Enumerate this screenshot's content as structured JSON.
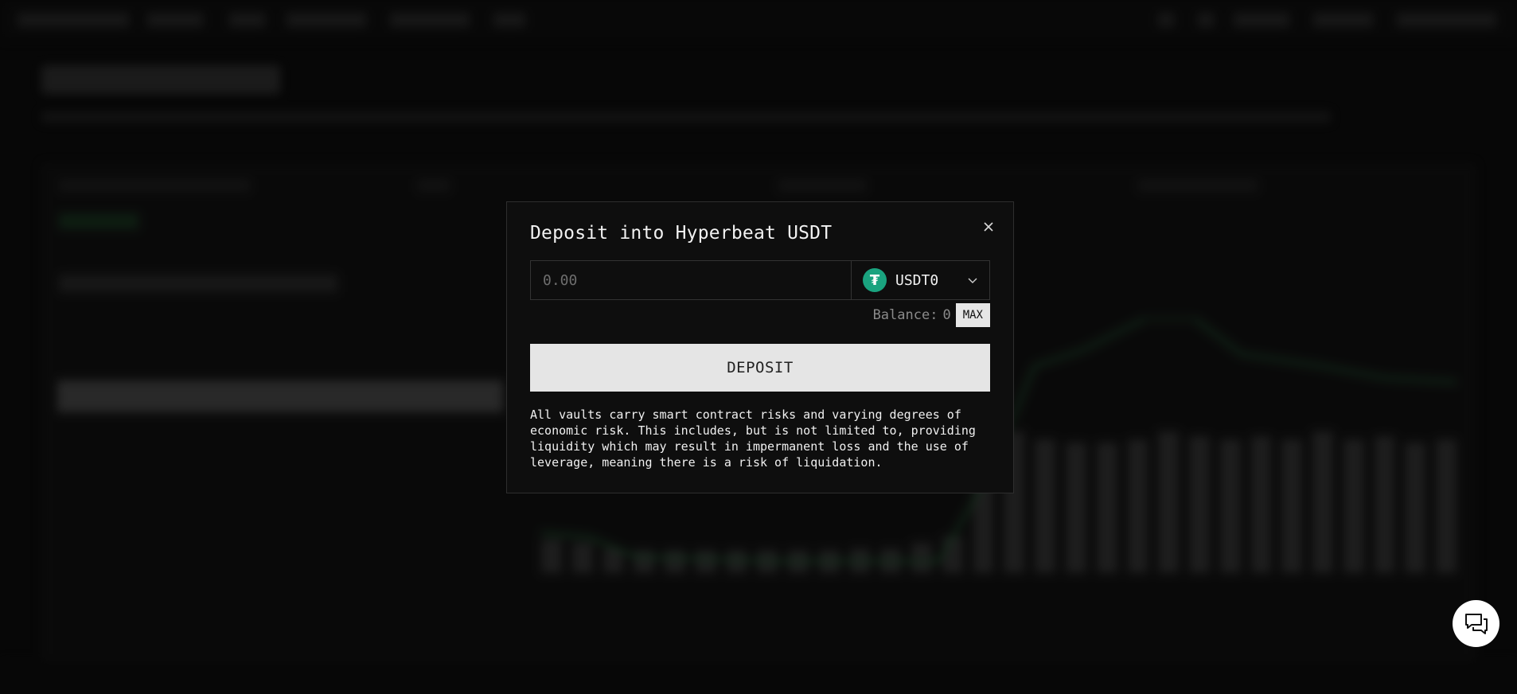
{
  "modal": {
    "title": "Deposit into Hyperbeat USDT",
    "amount_placeholder": "0.00",
    "amount_value": "",
    "token": {
      "symbol": "USDT0",
      "icon": "tether-icon",
      "icon_glyph": "₮",
      "color": "#1aa37f"
    },
    "balance_label": "Balance:",
    "balance_value": "0",
    "max_label": "MAX",
    "deposit_label": "DEPOSIT",
    "disclaimer": "All vaults carry smart contract risks and varying degrees of economic risk. This includes, but is not limited to, providing liquidity which may result in impermanent loss and the use of leverage, meaning there is a risk of liquidation.",
    "close_icon": "close-icon"
  },
  "chat": {
    "icon": "chat-support-icon"
  },
  "colors": {
    "background": "#0b0b0b",
    "modal_bg": "#0e0e0e",
    "accent": "#1aa37f",
    "button": "#e5e5e5"
  }
}
